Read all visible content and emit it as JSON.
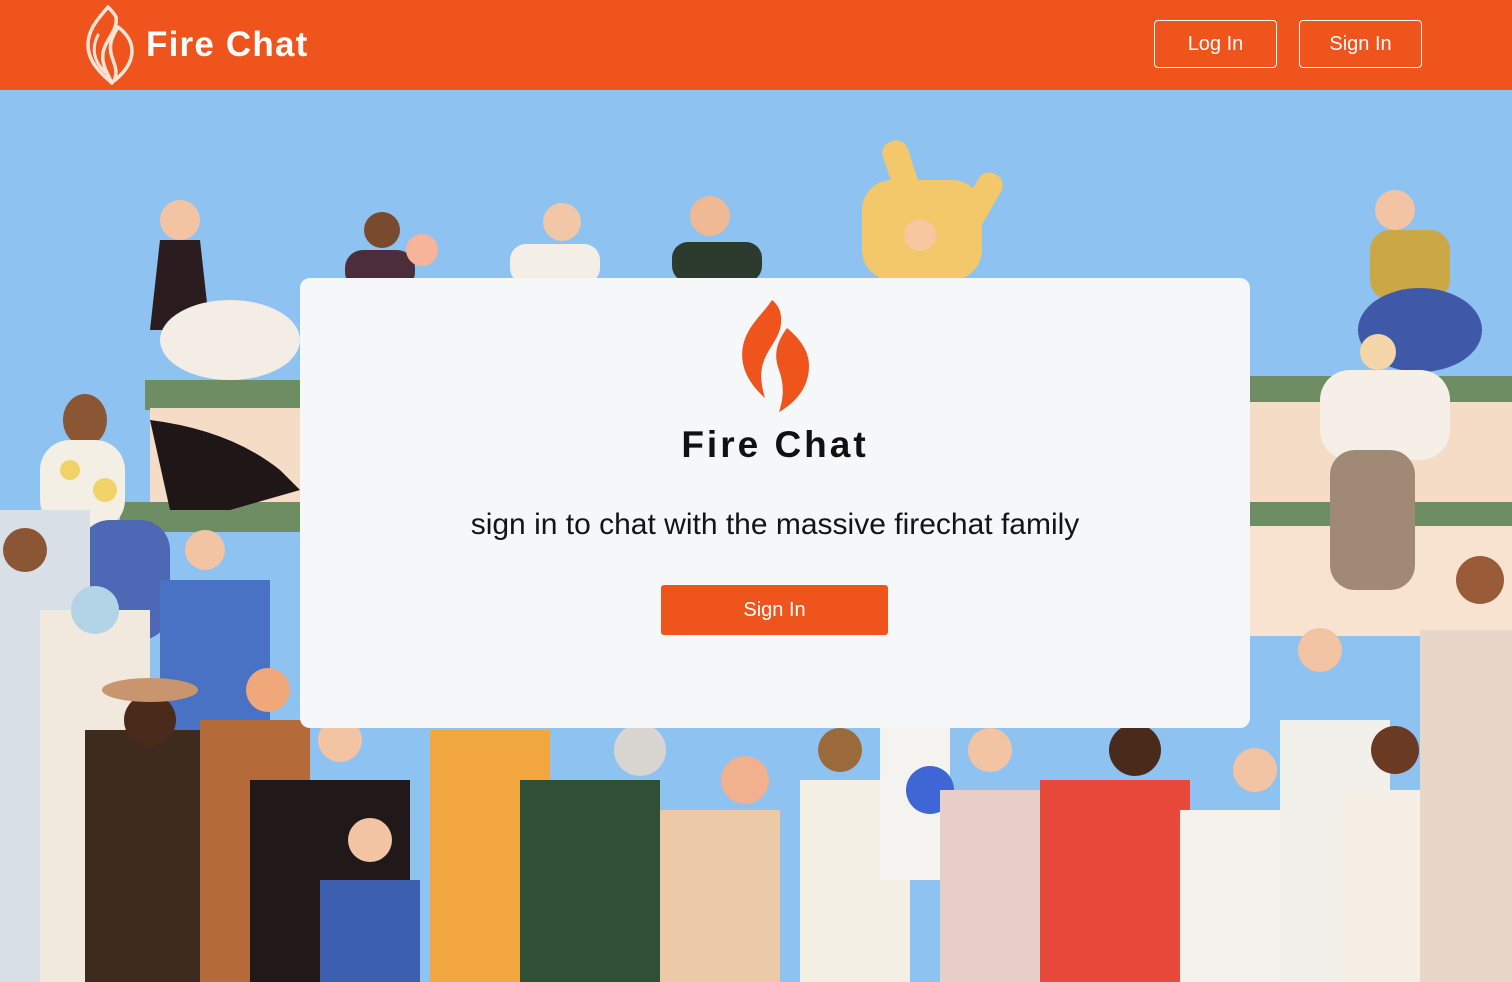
{
  "header": {
    "brand_name": "Fire Chat",
    "brand_icon": "flame-icon",
    "login_label": "Log In",
    "signin_label": "Sign In",
    "background_color": "#ef541c"
  },
  "hero": {
    "background_color": "#8ec2f0",
    "illustration": "crowd-illustration"
  },
  "card": {
    "logo_icon": "flame-icon",
    "title": "Fire Chat",
    "subtitle": "sign in to chat with the massive firechat family",
    "signin_label": "Sign In",
    "accent_color": "#ef541c"
  }
}
